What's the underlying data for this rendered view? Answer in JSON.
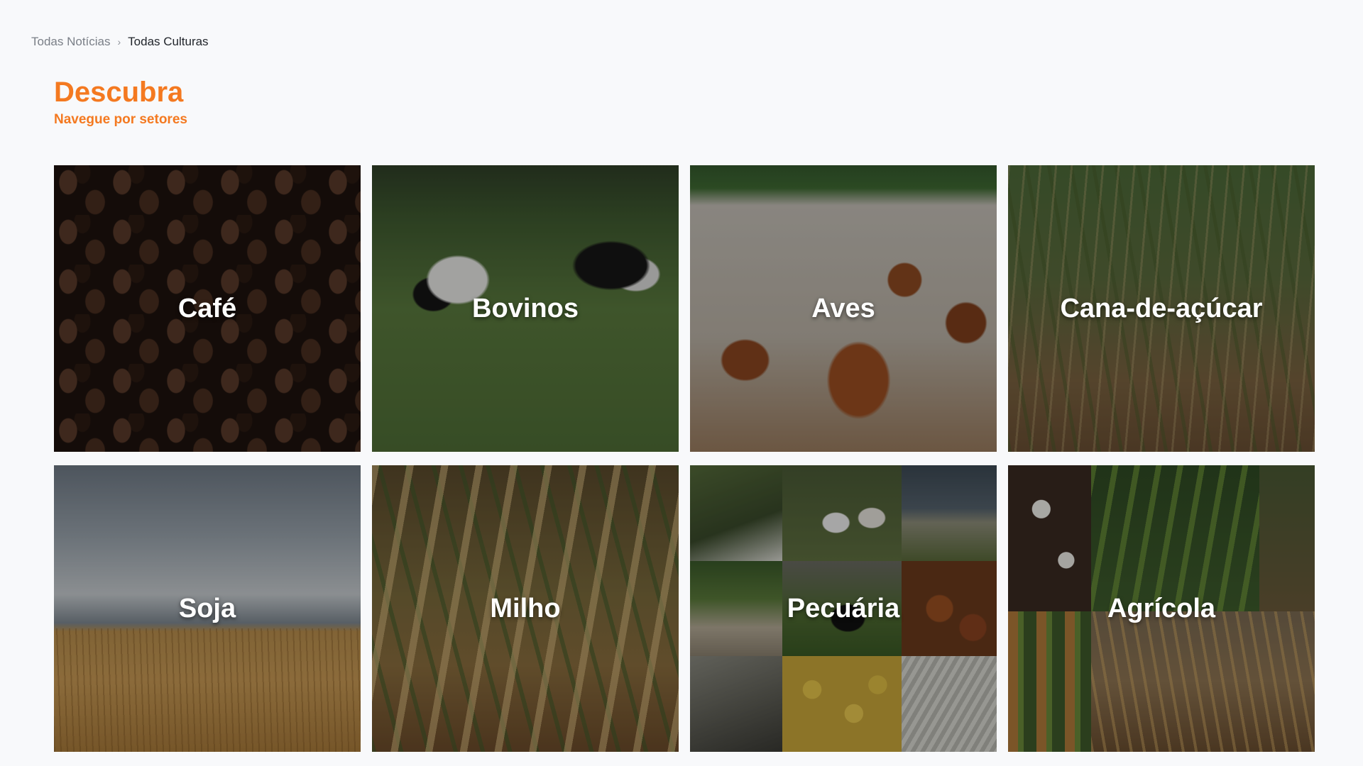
{
  "breadcrumb": {
    "items": [
      {
        "label": "Todas Notícias"
      },
      {
        "label": "Todas Culturas"
      }
    ],
    "separator": "›"
  },
  "header": {
    "title": "Descubra",
    "subtitle": "Navegue por setores",
    "accent_color": "#f47920"
  },
  "sectors": [
    {
      "label": "Café"
    },
    {
      "label": "Bovinos"
    },
    {
      "label": "Aves"
    },
    {
      "label": "Cana-de-açúcar"
    },
    {
      "label": "Soja"
    },
    {
      "label": "Milho"
    },
    {
      "label": "Pecuária"
    },
    {
      "label": "Agrícola"
    }
  ]
}
